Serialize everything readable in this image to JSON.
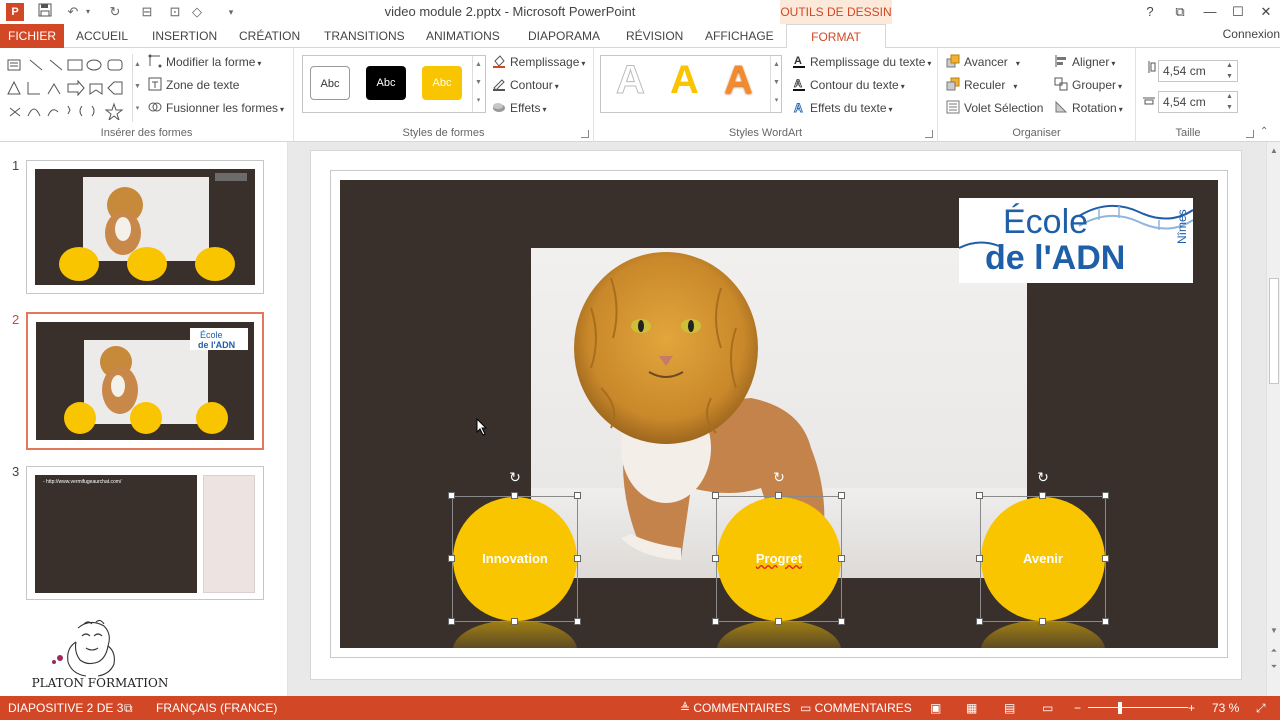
{
  "window": {
    "title": "video module 2.pptx - Microsoft PowerPoint",
    "context_tab_group": "OUTILS DE DESSIN",
    "app_icon_letter": "P"
  },
  "tabs": [
    "FICHIER",
    "ACCUEIL",
    "INSERTION",
    "CRÉATION",
    "TRANSITIONS",
    "ANIMATIONS",
    "DIAPORAMA",
    "RÉVISION",
    "AFFICHAGE",
    "FORMAT"
  ],
  "signin": "Connexion",
  "ribbon": {
    "insert_shapes": {
      "label": "Insérer des formes",
      "edit_shape": "Modifier la forme",
      "text_box": "Zone de texte",
      "merge_shapes": "Fusionner les formes"
    },
    "shape_styles": {
      "label": "Styles de formes",
      "style_sample": "Abc",
      "fill": "Remplissage",
      "outline": "Contour",
      "effects": "Effets"
    },
    "wordart": {
      "label": "Styles WordArt",
      "sample": "A",
      "text_fill": "Remplissage du texte",
      "text_outline": "Contour du texte",
      "text_effects": "Effets du texte"
    },
    "arrange": {
      "label": "Organiser",
      "bring_forward": "Avancer",
      "send_backward": "Reculer",
      "selection_pane": "Volet Sélection",
      "align": "Aligner",
      "group": "Grouper",
      "rotate": "Rotation"
    },
    "size": {
      "label": "Taille",
      "height": "4,54 cm",
      "width": "4,54 cm"
    }
  },
  "thumbnails": [
    {
      "number": "1"
    },
    {
      "number": "2"
    },
    {
      "number": "3",
      "url_text": "- http://www.vermifugeaurchat.com/"
    }
  ],
  "slide": {
    "logo_line1": "École",
    "logo_line2": "de l'ADN",
    "logo_city": "Nîmes",
    "circles": [
      "Innovation",
      "Progret",
      "Avenir"
    ]
  },
  "brand": {
    "name": "PLATON FORMATION"
  },
  "status": {
    "slide_counter": "DIAPOSITIVE 2 DE 3",
    "language": "FRANÇAIS (FRANCE)",
    "notes": "COMMENTAIRES",
    "comments": "COMMENTAIRES",
    "zoom": "73 %"
  },
  "colors": {
    "accent": "#d24726",
    "slide_bg": "#3a302b",
    "circle": "#f9c400",
    "logo_blue": "#1f5fa8"
  }
}
